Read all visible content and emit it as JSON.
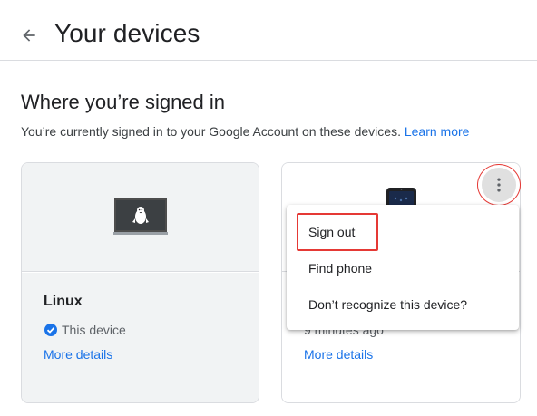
{
  "header": {
    "title": "Your devices",
    "back_icon": "arrow-left-icon"
  },
  "section": {
    "title": "Where you’re signed in",
    "description": "You’re currently signed in to your Google Account on these devices.",
    "learn_more": "Learn more"
  },
  "devices": [
    {
      "name": "Linux",
      "status": "This device",
      "more_details": "More details",
      "icon": "linux-laptop-icon"
    },
    {
      "last_active": "9 minutes ago",
      "more_details": "More details",
      "icon": "phone-icon"
    }
  ],
  "menu": {
    "items": [
      "Sign out",
      "Find phone",
      "Don’t recognize this device?"
    ]
  },
  "colors": {
    "link": "#1a73e8",
    "highlight": "#e53935",
    "divider": "#dadce0"
  }
}
